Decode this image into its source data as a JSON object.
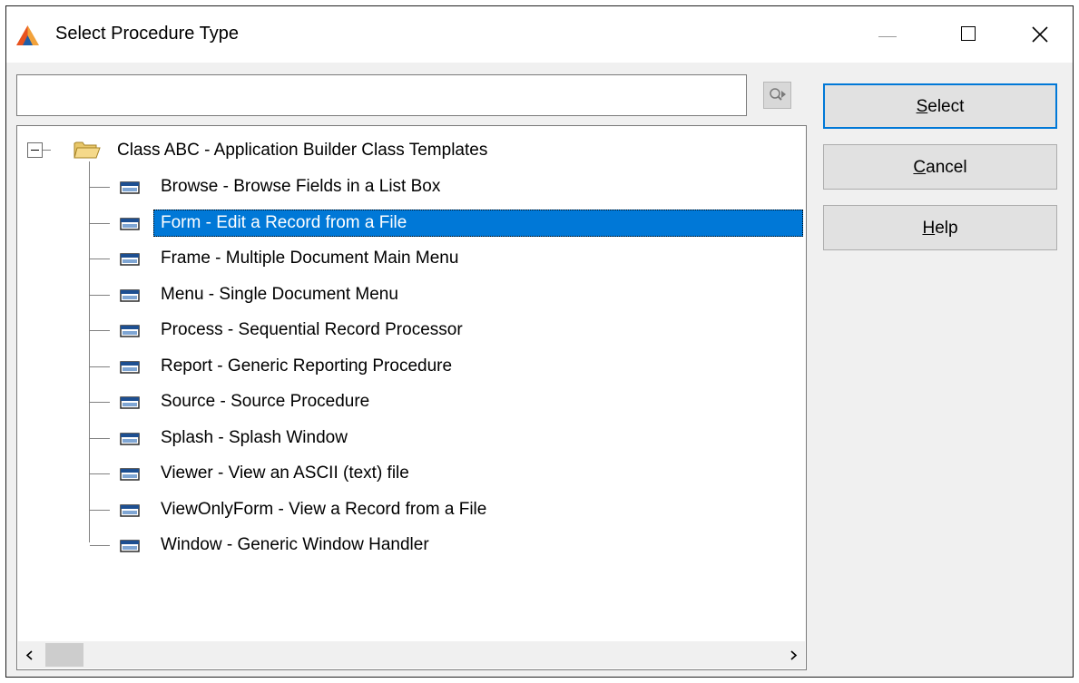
{
  "window": {
    "title": "Select Procedure Type",
    "controls": {
      "minimize_icon": "minimize-icon",
      "maximize_icon": "maximize-icon",
      "close_icon": "close-icon"
    }
  },
  "search": {
    "value": "",
    "placeholder": ""
  },
  "tree": {
    "root": {
      "label": "Class ABC - Application Builder Class Templates",
      "expanded": true,
      "icon": "open-folder-icon"
    },
    "items": [
      {
        "label": "Browse - Browse Fields in a List Box",
        "selected": false
      },
      {
        "label": "Form - Edit a Record from a File",
        "selected": true
      },
      {
        "label": "Frame - Multiple Document Main Menu",
        "selected": false
      },
      {
        "label": "Menu - Single Document Menu",
        "selected": false
      },
      {
        "label": "Process - Sequential Record Processor",
        "selected": false
      },
      {
        "label": "Report - Generic Reporting Procedure",
        "selected": false
      },
      {
        "label": "Source - Source Procedure",
        "selected": false
      },
      {
        "label": "Splash - Splash Window",
        "selected": false
      },
      {
        "label": "Viewer - View an ASCII (text) file",
        "selected": false
      },
      {
        "label": "ViewOnlyForm - View a Record from a File",
        "selected": false
      },
      {
        "label": "Window - Generic Window Handler",
        "selected": false
      }
    ]
  },
  "buttons": {
    "select": {
      "mnemonic": "S",
      "rest": "elect"
    },
    "cancel": {
      "mnemonic": "C",
      "rest": "ancel"
    },
    "help": {
      "mnemonic": "H",
      "rest": "elp"
    }
  },
  "colors": {
    "selection": "#0078d7",
    "default_button_border": "#0078d7",
    "dialog_bg": "#f0f0f0"
  }
}
